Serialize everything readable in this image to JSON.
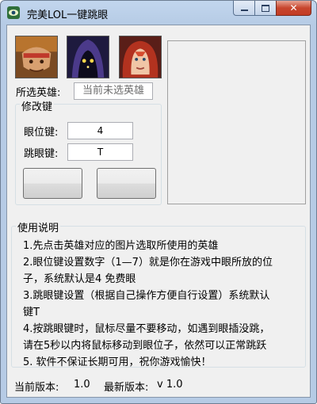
{
  "window": {
    "title": "完美LOL一键跳眼"
  },
  "heroes": [
    {
      "name": "hero-1",
      "color_bg": "#8a5a2a"
    },
    {
      "name": "hero-2",
      "color_bg": "#2a2350"
    },
    {
      "name": "hero-3",
      "color_bg": "#6a2a22"
    }
  ],
  "selected_hero": {
    "label": "所选英雄:",
    "value": "当前未选英雄"
  },
  "hotkeys": {
    "group_title": "修改键",
    "ward_label": "眼位键:",
    "ward_value": "4",
    "jump_label": "跳眼键:",
    "jump_value": "T"
  },
  "instructions": {
    "title": "使用说明",
    "lines": [
      "1.先点击英雄对应的图片选取所使用的英雄",
      "2.眼位键设置数字（1—7）就是你在游戏中眼所放的位",
      "  子，系统默认是4 免费眼",
      "3.跳眼键设置（根据自己操作方便自行设置）系统默认",
      "  键T",
      "4.按跳眼键时，鼠标尽量不要移动，如遇到眼插没跳，",
      "  请在5秒以内将鼠标移动到眼位子，依然可以正常跳跃",
      "5. 软件不保证长期可用，祝你游戏愉快！"
    ]
  },
  "status": {
    "current_label": "当前版本:",
    "current_value": "1.0",
    "latest_label": "最新版本:",
    "latest_value": "v 1.0"
  }
}
